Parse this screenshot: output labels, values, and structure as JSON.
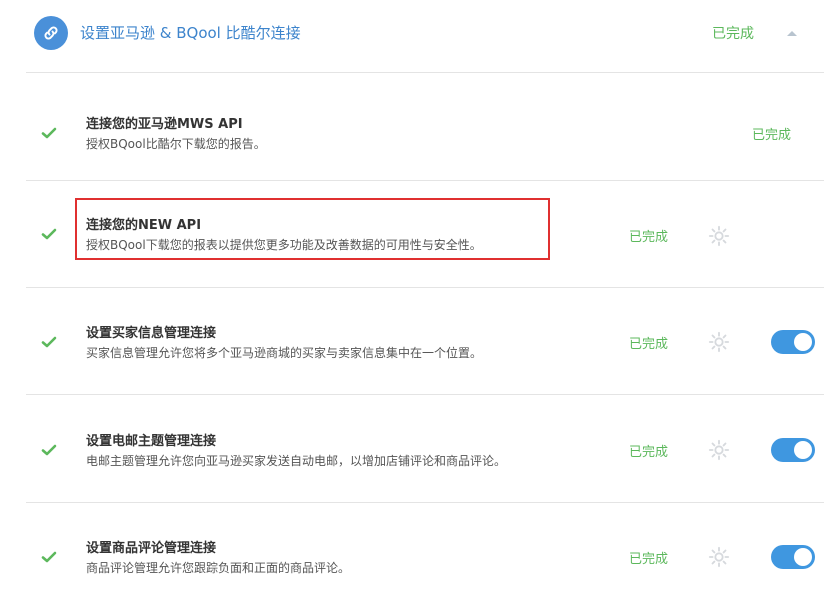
{
  "header": {
    "title": "设置亚马逊 & BQool 比酷尔连接",
    "status": "已完成",
    "icon": "link-icon",
    "chevron_icon": "chevron-up-icon"
  },
  "colors": {
    "accent": "#3d84cc",
    "success": "#5cb85c",
    "toggle_on": "#3f97e0",
    "highlight": "#e03030"
  },
  "rows": [
    {
      "title": "连接您的亚马逊MWS API",
      "description": "授权BQool比酷尔下载您的报告。",
      "status": "已完成",
      "has_gear": false,
      "has_toggle": false,
      "toggle_on": null
    },
    {
      "title": "连接您的NEW API",
      "description": "授权BQool下载您的报表以提供您更多功能及改善数据的可用性与安全性。",
      "status": "已完成",
      "has_gear": true,
      "has_toggle": false,
      "toggle_on": null,
      "highlighted": true
    },
    {
      "title": "设置买家信息管理连接",
      "description": "买家信息管理允许您将多个亚马逊商城的买家与卖家信息集中在一个位置。",
      "status": "已完成",
      "has_gear": true,
      "has_toggle": true,
      "toggle_on": true
    },
    {
      "title": "设置电邮主题管理连接",
      "description": "电邮主题管理允许您向亚马逊买家发送自动电邮，以增加店铺评论和商品评论。",
      "status": "已完成",
      "has_gear": true,
      "has_toggle": true,
      "toggle_on": true
    },
    {
      "title": "设置商品评论管理连接",
      "description": "商品评论管理允许您跟踪负面和正面的商品评论。",
      "status": "已完成",
      "has_gear": true,
      "has_toggle": true,
      "toggle_on": true
    }
  ]
}
